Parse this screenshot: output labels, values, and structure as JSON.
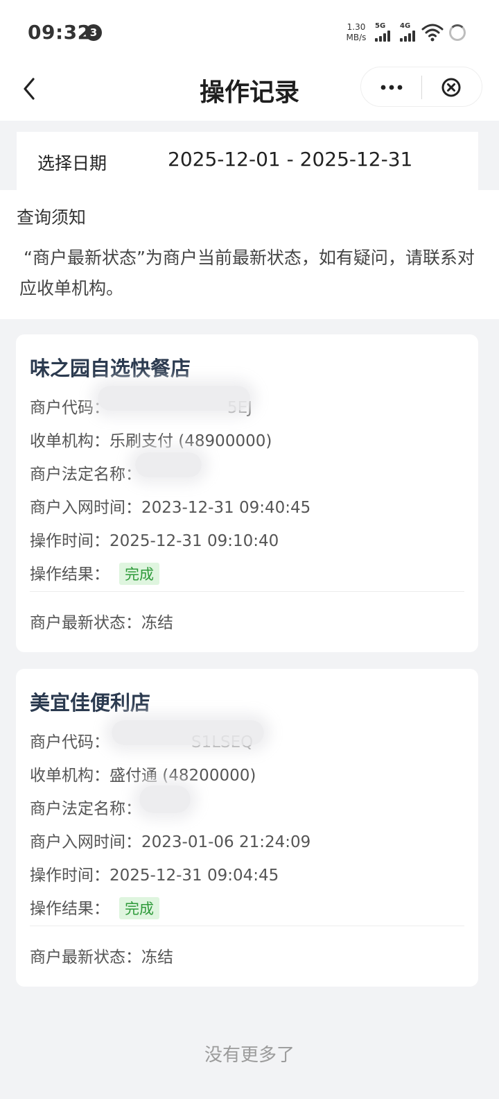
{
  "status": {
    "time": "09:32",
    "notification_count": "3",
    "net_speed_top": "1.30",
    "net_speed_bottom": "MB/s",
    "sig1": "5G",
    "sig2": "4G"
  },
  "nav": {
    "title": "操作记录"
  },
  "filter": {
    "date_label": "选择日期",
    "date_range": "2025-12-01 - 2025-12-31"
  },
  "notice": {
    "title": "查询须知",
    "text": "“商户最新状态”为商户当前最新状态，如有疑问，请联系对应收单机构。"
  },
  "records": [
    {
      "name": "味之园自选快餐店",
      "merchant_code_label": "商户代码：",
      "merchant_code_visible": "5EJ",
      "acquirer_label": "收单机构：",
      "acquirer": "乐刷支付 (48900000)",
      "legal_name_label": "商户法定名称：",
      "legal_name_visible": "",
      "join_time_label": "商户入网时间：",
      "join_time": "2023-12-31 09:40:45",
      "op_time_label": "操作时间：",
      "op_time": "2025-12-31 09:10:40",
      "result_label": "操作结果：",
      "result": "完成",
      "status_label": "商户最新状态：",
      "status": "冻结"
    },
    {
      "name": "美宜佳便利店",
      "merchant_code_label": "商户代码：",
      "merchant_code_visible": "S1LSEQ",
      "acquirer_label": "收单机构：",
      "acquirer": "盛付通 (48200000)",
      "legal_name_label": "商户法定名称：",
      "legal_name_visible": "",
      "join_time_label": "商户入网时间：",
      "join_time": "2023-01-06 21:24:09",
      "op_time_label": "操作时间：",
      "op_time": "2025-12-31 09:04:45",
      "result_label": "操作结果：",
      "result": "完成",
      "status_label": "商户最新状态：",
      "status": "冻结"
    }
  ],
  "footer": {
    "no_more": "没有更多了"
  },
  "colors": {
    "badge_bg": "#dff5df",
    "badge_text": "#2e9a3a",
    "title_text": "#2b3a4f"
  }
}
